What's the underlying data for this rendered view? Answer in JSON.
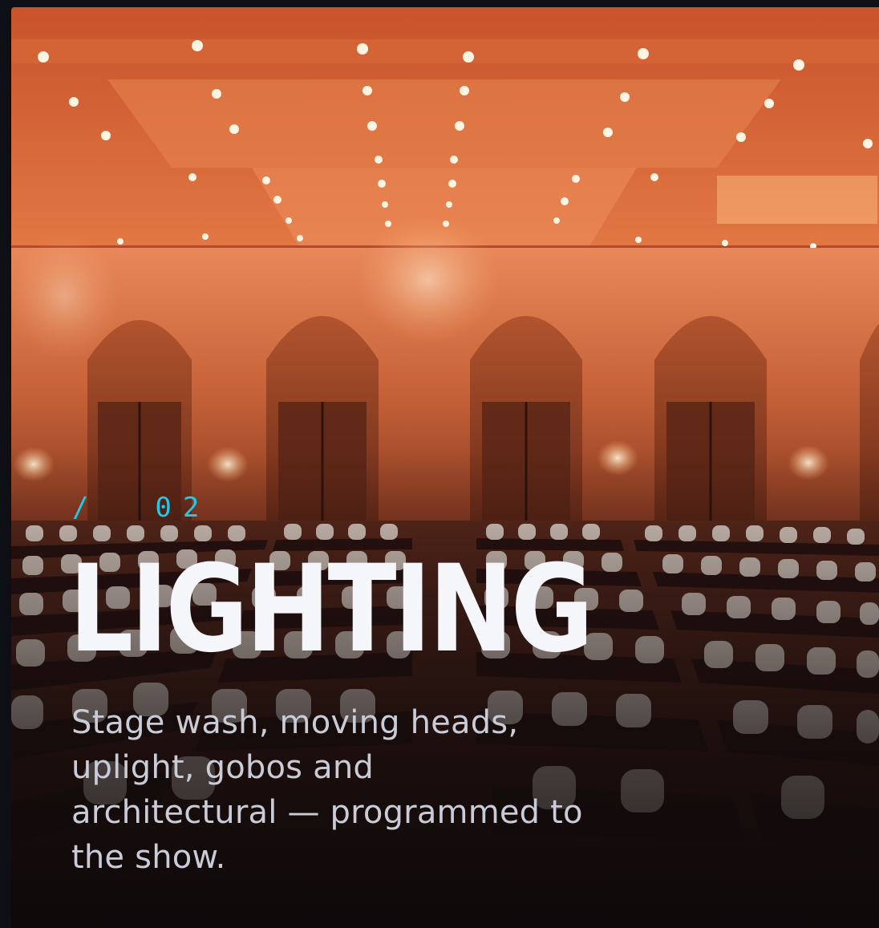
{
  "card": {
    "index_label": "/  02",
    "title": "LIGHTING",
    "description": "Stage wash, moving heads, uplight, gobos and architectural — programmed to the show.",
    "image_subject": "ballroom-with-uplighting"
  },
  "colors": {
    "accent": "#22c9e8",
    "title": "#f5f6fa",
    "body_text": "#c9ccd6",
    "page_background": "#0d0f14",
    "warm_light": "#e0713c"
  }
}
